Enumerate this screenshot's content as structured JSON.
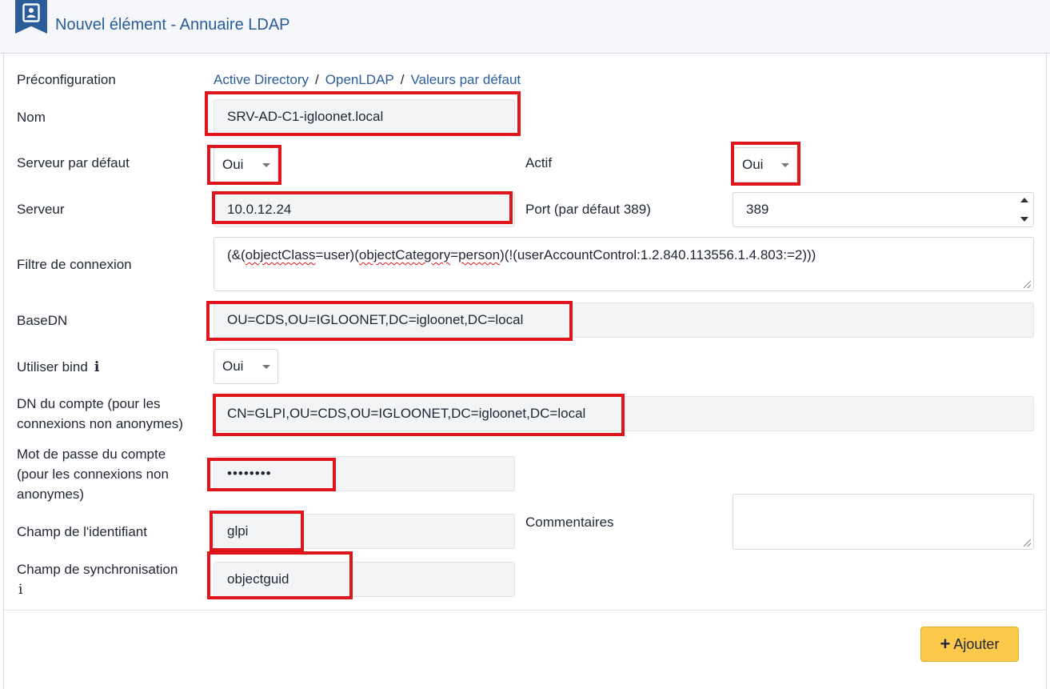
{
  "header": {
    "title": "Nouvel élément - Annuaire LDAP",
    "icon": "address-book-icon"
  },
  "preconfiguration": {
    "label": "Préconfiguration",
    "links": [
      "Active Directory",
      "OpenLDAP",
      "Valeurs par défaut"
    ],
    "separator": "/"
  },
  "fields": {
    "nom": {
      "label": "Nom",
      "value": "SRV-AD-C1-igloonet.local"
    },
    "serveur_defaut": {
      "label": "Serveur par défaut",
      "value": "Oui"
    },
    "actif": {
      "label": "Actif",
      "value": "Oui"
    },
    "serveur": {
      "label": "Serveur",
      "value": "10.0.12.24"
    },
    "port": {
      "label": "Port (par défaut 389)",
      "value": "389"
    },
    "filtre": {
      "label": "Filtre de connexion",
      "parts": [
        "(&(",
        "objectClass",
        "=user)(",
        "objectCategory",
        "=",
        "person",
        ")(!(userAccountControl:1.2.840.113556.1.4.803:=2)))"
      ]
    },
    "basedn": {
      "label": "BaseDN",
      "value": "OU=CDS,OU=IGLOONET,DC=igloonet,DC=local"
    },
    "bind": {
      "label": "Utiliser bind",
      "info": "i",
      "value": "Oui"
    },
    "dn_compte": {
      "label_line1": "DN du compte (pour les",
      "label_line2": "connexions non anonymes)",
      "value": "CN=GLPI,OU=CDS,OU=IGLOONET,DC=igloonet,DC=local"
    },
    "mot_de_passe": {
      "label_line1": "Mot de passe du compte",
      "label_line2": "(pour les connexions non",
      "label_line3": "anonymes)",
      "value": "••••••••"
    },
    "commentaires": {
      "label": "Commentaires",
      "value": ""
    },
    "champ_identifiant": {
      "label": "Champ de l'identifiant",
      "value": "glpi"
    },
    "champ_sync": {
      "label": "Champ de synchronisation",
      "info": "i",
      "value": "objectguid"
    }
  },
  "actions": {
    "add_label": "Ajouter",
    "add_icon": "plus-icon"
  },
  "colors": {
    "accent": "#2a5c9a",
    "highlight": "#e0151b",
    "button": "#fdc94b"
  }
}
